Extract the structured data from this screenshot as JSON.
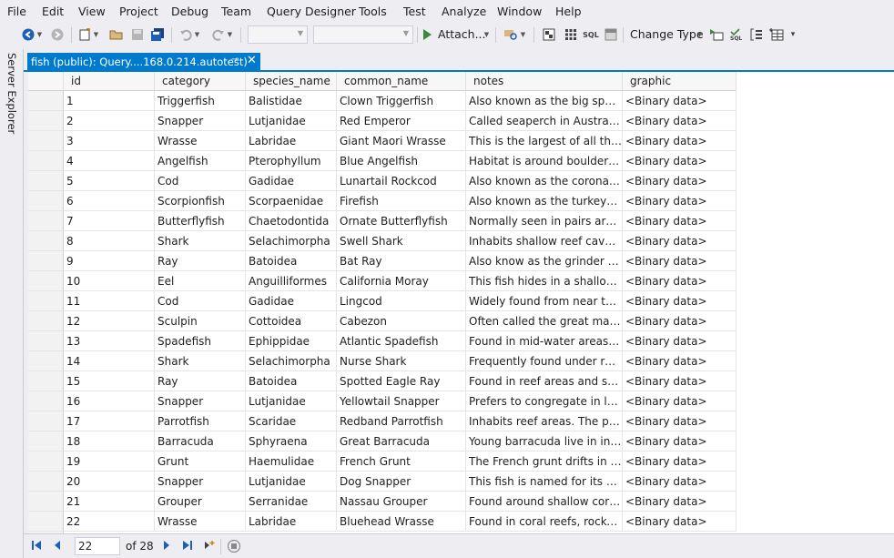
{
  "menu": [
    "File",
    "Edit",
    "View",
    "Project",
    "Debug",
    "Team",
    "Query Designer",
    "Tools",
    "Test",
    "Analyze",
    "Window",
    "Help"
  ],
  "toolbar": {
    "attach_label": "Attach...",
    "change_type_label": "Change Type",
    "sql_label": "SQL"
  },
  "side_panel": {
    "server_explorer": "Server Explorer"
  },
  "document_tab": {
    "title": "fish (public): Query....168.0.214.autotest)"
  },
  "grid": {
    "columns": [
      "id",
      "category",
      "species_name",
      "common_name",
      "notes",
      "graphic"
    ],
    "rows": [
      [
        "1",
        "Triggerfish",
        "Balistidae",
        "Clown Triggerfish",
        "Also known as the big spotte...",
        "<Binary data>"
      ],
      [
        "2",
        "Snapper",
        "Lutjanidae",
        "Red Emperor",
        "Called seaperch in Australia. ...",
        "<Binary data>"
      ],
      [
        "3",
        "Wrasse",
        "Labridae",
        "Giant Maori Wrasse",
        "This is the largest of all the w...",
        "<Binary data>"
      ],
      [
        "4",
        "Angelfish",
        "Pterophyllum",
        "Blue Angelfish",
        "Habitat is around boulders, c...",
        "<Binary data>"
      ],
      [
        "5",
        "Cod",
        "Gadidae",
        "Lunartail Rockcod",
        "Also known as the coronatio...",
        "<Binary data>"
      ],
      [
        "6",
        "Scorpionfish",
        "Scorpaenidae",
        "Firefish",
        "Also known as the turkeyfish....",
        "<Binary data>"
      ],
      [
        "7",
        "Butterflyfish",
        "Chaetodontida",
        "Ornate Butterflyfish",
        "Normally seen in pairs aroun...",
        "<Binary data>"
      ],
      [
        "8",
        "Shark",
        "Selachimorpha",
        "Swell Shark",
        "Inhabits shallow reef caves a...",
        "<Binary data>"
      ],
      [
        "9",
        "Ray",
        "Batoidea",
        "Bat Ray",
        "Also know as the grinder ray ...",
        "<Binary data>"
      ],
      [
        "10",
        "Eel",
        "Anguilliformes",
        "California Moray",
        "This fish hides in a shallow-w...",
        "<Binary data>"
      ],
      [
        "11",
        "Cod",
        "Gadidae",
        "Lingcod",
        "Widely found from near the s...",
        "<Binary data>"
      ],
      [
        "12",
        "Sculpin",
        "Cottoidea",
        "Cabezon",
        "Often called the great marble...",
        "<Binary data>"
      ],
      [
        "13",
        "Spadefish",
        "Ephippidae",
        "Atlantic Spadefish",
        "Found in mid-water areas aro...",
        "<Binary data>"
      ],
      [
        "14",
        "Shark",
        "Selachimorpha",
        "Nurse Shark",
        "Frequently found under rock ...",
        "<Binary data>"
      ],
      [
        "15",
        "Ray",
        "Batoidea",
        "Spotted Eagle Ray",
        "Found in reef areas and sand...",
        "<Binary data>"
      ],
      [
        "16",
        "Snapper",
        "Lutjanidae",
        "Yellowtail Snapper",
        "Prefers to congregate in loos...",
        "<Binary data>"
      ],
      [
        "17",
        "Parrotfish",
        "Scaridae",
        "Redband Parrotfish",
        "Inhabits reef areas.  The parro...",
        "<Binary data>"
      ],
      [
        "18",
        "Barracuda",
        "Sphyraena",
        "Great Barracuda",
        "Young barracuda live in insh...",
        "<Binary data>"
      ],
      [
        "19",
        "Grunt",
        "Haemulidae",
        "French Grunt",
        "The French grunt drifts in lar...",
        "<Binary data>"
      ],
      [
        "20",
        "Snapper",
        "Lutjanidae",
        "Dog Snapper",
        "This fish is named for its elon...",
        "<Binary data>"
      ],
      [
        "21",
        "Grouper",
        "Serranidae",
        "Nassau Grouper",
        "Found around shallow coral r...",
        "<Binary data>"
      ],
      [
        "22",
        "Wrasse",
        "Labridae",
        "Bluehead Wrasse",
        "Found in coral reefs, rocky fla...",
        "<Binary data>"
      ]
    ]
  },
  "navigation": {
    "current_record": "22",
    "total_label": "of 28"
  }
}
